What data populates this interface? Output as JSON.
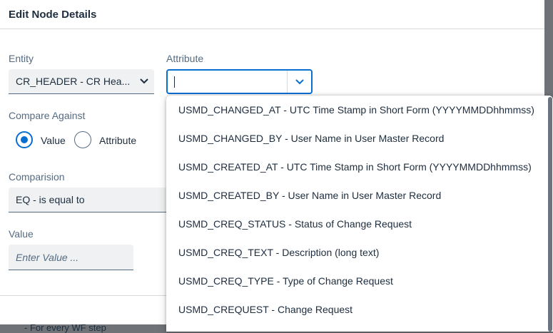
{
  "background": {
    "partial_text": "- For every WF step"
  },
  "dialog": {
    "title": "Edit Node Details"
  },
  "entity": {
    "label": "Entity",
    "value": "CR_HEADER - CR Hea..."
  },
  "attribute": {
    "label": "Attribute",
    "value": ""
  },
  "compare_against": {
    "label": "Compare Against",
    "options": [
      {
        "label": "Value",
        "selected": true
      },
      {
        "label": "Attribute",
        "selected": false
      }
    ]
  },
  "comparision": {
    "label": "Comparision",
    "value": "EQ - is equal to"
  },
  "value": {
    "label": "Value",
    "placeholder": "Enter Value ..."
  },
  "attribute_dropdown": {
    "items": [
      "USMD_CHANGED_AT - UTC Time Stamp in Short Form (YYYYMMDDhhmmss)",
      "USMD_CHANGED_BY - User Name in User Master Record",
      "USMD_CREATED_AT - UTC Time Stamp in Short Form (YYYYMMDDhhmmss)",
      "USMD_CREATED_BY - User Name in User Master Record",
      "USMD_CREQ_STATUS - Status of Change Request",
      "USMD_CREQ_TEXT - Description (long text)",
      "USMD_CREQ_TYPE - Type of Change Request",
      "USMD_CREQUEST - Change Request"
    ]
  },
  "colors": {
    "accent": "#0a6ed1",
    "text": "#1d2d3e",
    "label": "#556b82",
    "field_bg": "#eff1f2"
  },
  "icons": {
    "dropdown": "chevron-down-icon"
  }
}
